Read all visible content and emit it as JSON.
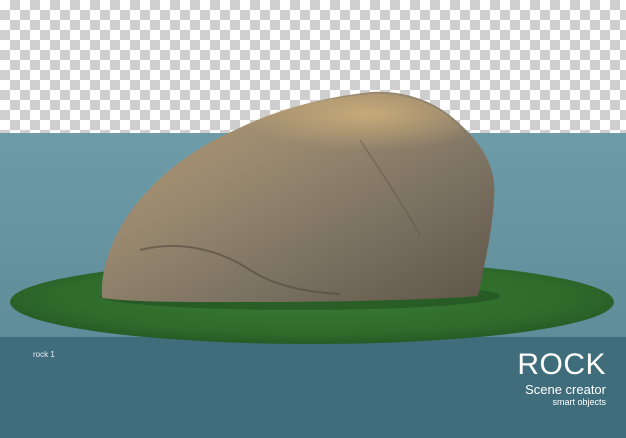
{
  "caption": "rock 1",
  "brand": {
    "title": "ROCK",
    "subtitle": "Scene creator",
    "tagline": "smart objects"
  },
  "colors": {
    "backdrop": "#6e9ba8",
    "floor_band": "#3f6d7c",
    "grass": "#2f6b2b",
    "rock": "#8a7a63"
  }
}
